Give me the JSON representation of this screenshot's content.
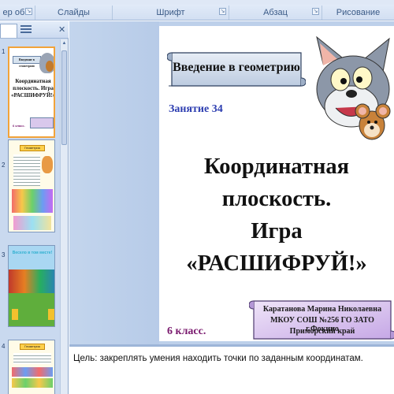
{
  "ribbon": {
    "groups": [
      {
        "label": "Буфер об...",
        "display": "ер об..."
      },
      {
        "label": "Слайды"
      },
      {
        "label": "Шрифт"
      },
      {
        "label": "Абзац"
      },
      {
        "label": "Рисование"
      }
    ]
  },
  "thumbnail_pane": {
    "slide_numbers": [
      "1",
      "2",
      "3",
      "4"
    ],
    "slides": [
      {
        "title": "Введение в геометрию",
        "subtitle": "Координатная плоскость. Игра «РАСШИФРУЙ!»",
        "footer": "6 класс."
      },
      {
        "title": "Геометрия"
      },
      {
        "title": "Весело в том месте!"
      },
      {
        "title": "Геометрия"
      }
    ]
  },
  "slide": {
    "course_title": "Введение в геометрию",
    "lesson": "Занятие 34",
    "heading_line1": "Координатная плоскость.",
    "heading_line2": "Игра «РАСШИФРУЙ!»",
    "grade": "6 класс.",
    "author": {
      "name": "Каратанова Марина Николаевна",
      "school": "МКОУ СОШ №256 ГО ЗАТО г.Фокино",
      "region": "Приморский край"
    }
  },
  "notes": {
    "text": "Цель: закреплять умения находить точки по заданным координатам."
  },
  "colors": {
    "ribbon": "#d2dff2",
    "pane": "#c9d9ef",
    "lesson_text": "#2c3db0",
    "grade_text": "#7a1a6e",
    "active_thumb_border": "#f2a33a"
  },
  "icons": [
    "launcher-icon",
    "slides-tab-icon",
    "outline-tab-icon",
    "close-icon"
  ]
}
